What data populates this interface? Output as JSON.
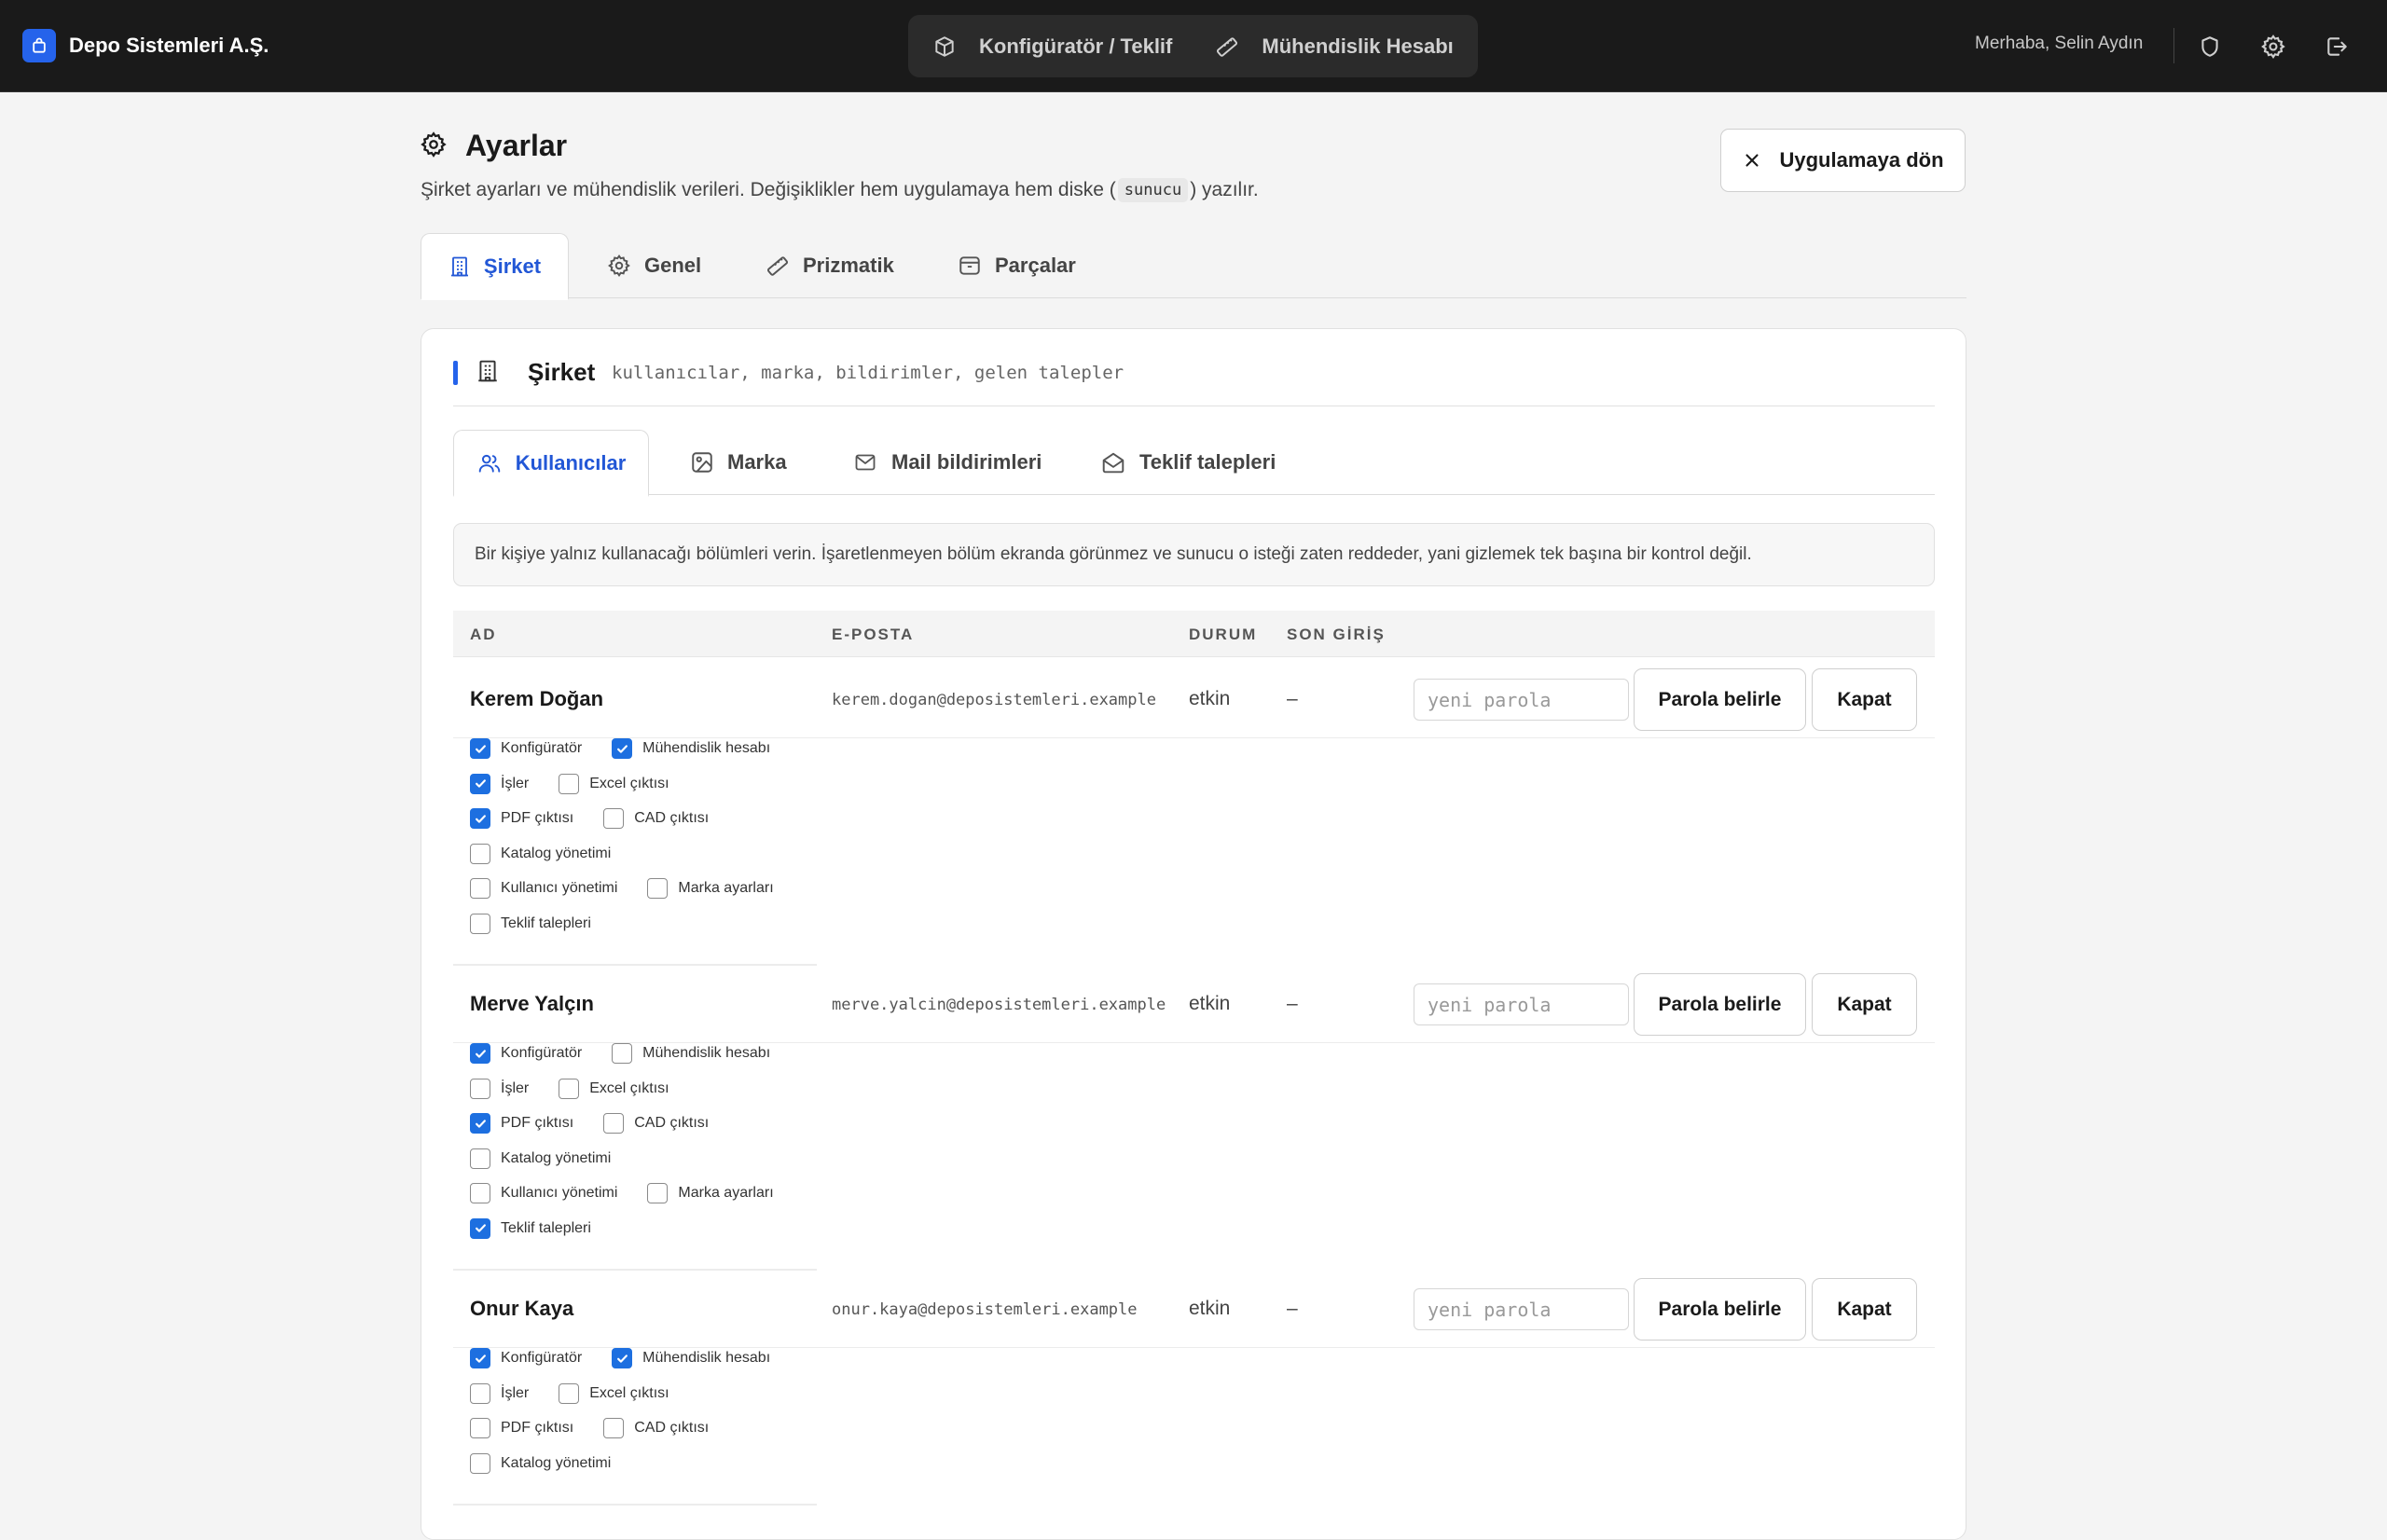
{
  "app": {
    "brand": "Depo Sistemleri A.Ş."
  },
  "topnav": {
    "items": [
      "Konfigüratör / Teklif",
      "Mühendislik Hesabı"
    ],
    "greeting": "Merhaba, Selin Aydın"
  },
  "header": {
    "title": "Ayarlar",
    "subtitle_before": "Şirket ayarları ve mühendislik verileri. Değişiklikler hem uygulamaya hem diske (",
    "subtitle_code": "sunucu",
    "subtitle_after": ") yazılır.",
    "back_button": "Uygulamaya dön"
  },
  "main_tabs": {
    "active": "Şirket",
    "items": [
      "Şirket",
      "Genel",
      "Prizmatik",
      "Parçalar"
    ]
  },
  "section": {
    "title": "Şirket",
    "description": "kullanıcılar, marka, bildirimler, gelen talepler"
  },
  "sub_tabs": {
    "active": "Kullanıcılar",
    "items": [
      "Kullanıcılar",
      "Marka",
      "Mail bildirimleri",
      "Teklif talepleri"
    ]
  },
  "notice": "Bir kişiye yalnız kullanacağı bölümleri verin. İşaretlenmeyen bölüm ekranda görünmez ve sunucu o isteği zaten reddeder, yani gizlemek tek başına bir kontrol değil.",
  "table": {
    "columns": [
      "AD",
      "E-POSTA",
      "DURUM",
      "SON GİRİŞ"
    ],
    "password_placeholder": "yeni parola",
    "set_password_label": "Parola belirle",
    "close_label": "Kapat",
    "users": [
      {
        "name": "Kerem Doğan",
        "email": "kerem.dogan@deposistemleri.example",
        "status": "etkin",
        "last_login": "–",
        "permissions": [
          [
            {
              "label": "Konfigüratör",
              "checked": true
            },
            {
              "label": "Mühendislik hesabı",
              "checked": true
            }
          ],
          [
            {
              "label": "İşler",
              "checked": true
            },
            {
              "label": "Excel çıktısı",
              "checked": false
            }
          ],
          [
            {
              "label": "PDF çıktısı",
              "checked": true
            },
            {
              "label": "CAD çıktısı",
              "checked": false
            }
          ],
          [
            {
              "label": "Katalog yönetimi",
              "checked": false
            }
          ],
          [
            {
              "label": "Kullanıcı yönetimi",
              "checked": false
            },
            {
              "label": "Marka ayarları",
              "checked": false
            }
          ],
          [
            {
              "label": "Teklif talepleri",
              "checked": false
            }
          ]
        ]
      },
      {
        "name": "Merve Yalçın",
        "email": "merve.yalcin@deposistemleri.example",
        "status": "etkin",
        "last_login": "–",
        "permissions": [
          [
            {
              "label": "Konfigüratör",
              "checked": true
            },
            {
              "label": "Mühendislik hesabı",
              "checked": false
            }
          ],
          [
            {
              "label": "İşler",
              "checked": false
            },
            {
              "label": "Excel çıktısı",
              "checked": false
            }
          ],
          [
            {
              "label": "PDF çıktısı",
              "checked": true
            },
            {
              "label": "CAD çıktısı",
              "checked": false
            }
          ],
          [
            {
              "label": "Katalog yönetimi",
              "checked": false
            }
          ],
          [
            {
              "label": "Kullanıcı yönetimi",
              "checked": false
            },
            {
              "label": "Marka ayarları",
              "checked": false
            }
          ],
          [
            {
              "label": "Teklif talepleri",
              "checked": true
            }
          ]
        ]
      },
      {
        "name": "Onur Kaya",
        "email": "onur.kaya@deposistemleri.example",
        "status": "etkin",
        "last_login": "–",
        "permissions": [
          [
            {
              "label": "Konfigüratör",
              "checked": true
            },
            {
              "label": "Mühendislik hesabı",
              "checked": true
            }
          ],
          [
            {
              "label": "İşler",
              "checked": false
            },
            {
              "label": "Excel çıktısı",
              "checked": false
            }
          ],
          [
            {
              "label": "PDF çıktısı",
              "checked": false
            },
            {
              "label": "CAD çıktısı",
              "checked": false
            }
          ],
          [
            {
              "label": "Katalog yönetimi",
              "checked": false
            }
          ]
        ]
      }
    ]
  },
  "colors": {
    "accent": "#2563eb",
    "active_tab_text": "#2257d6",
    "topbar": "#1a1a1a",
    "checkbox_on": "#1d6fe0"
  },
  "icons": [
    "box-icon",
    "cube-icon",
    "ruler-icon",
    "shield-icon",
    "gear-icon",
    "logout-icon",
    "close-icon",
    "building-icon",
    "users-icon",
    "image-icon",
    "mail-icon",
    "mail-open-icon",
    "package-icon"
  ]
}
